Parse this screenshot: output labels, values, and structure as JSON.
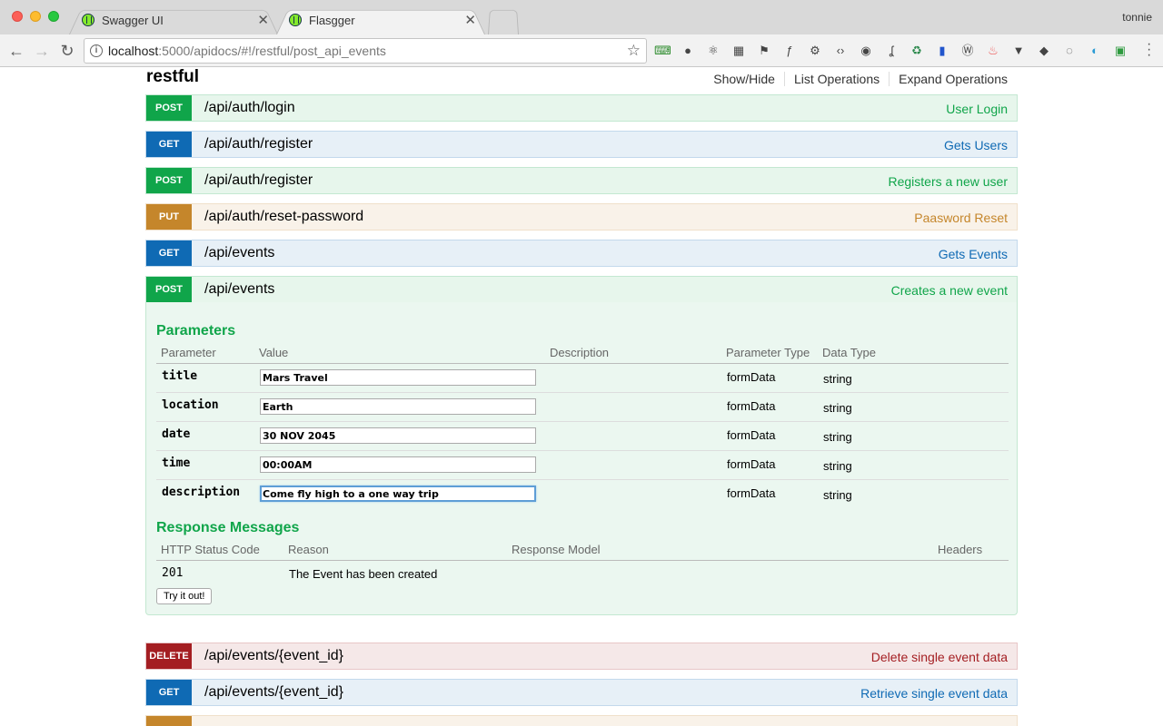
{
  "browser": {
    "tabs": [
      {
        "title": "Swagger UI",
        "active": false
      },
      {
        "title": "Flasgger",
        "active": true
      }
    ],
    "profile_name": "tonnie",
    "url_host": "localhost",
    "url_rest": ":5000/apidocs/#!/restful/post_api_events",
    "extensions": [
      "code-new-icon",
      "bulb-icon",
      "react-icon",
      "grid-icon",
      "tag-icon",
      "fx-icon",
      "gear-globe-icon",
      "code-icon",
      "eye-icon",
      "hook-icon",
      "recycle-icon",
      "pin-icon",
      "wordpress-icon",
      "fire-icon",
      "vee-icon",
      "dropbox-icon",
      "bulb-outline-icon",
      "cw-icon",
      "cors-icon"
    ]
  },
  "resource": {
    "title": "restful",
    "links": [
      "Show/Hide",
      "List Operations",
      "Expand Operations"
    ]
  },
  "operations": [
    {
      "method": "POST",
      "path": "/api/auth/login",
      "summary": "User Login"
    },
    {
      "method": "GET",
      "path": "/api/auth/register",
      "summary": "Gets Users"
    },
    {
      "method": "POST",
      "path": "/api/auth/register",
      "summary": "Registers a new user"
    },
    {
      "method": "PUT",
      "path": "/api/auth/reset-password",
      "summary": "Paasword Reset"
    },
    {
      "method": "GET",
      "path": "/api/events",
      "summary": "Gets Events"
    },
    {
      "method": "POST",
      "path": "/api/events",
      "summary": "Creates a new event"
    },
    {
      "method": "DELETE",
      "path": "/api/events/{event_id}",
      "summary": "Delete single event data"
    },
    {
      "method": "GET",
      "path": "/api/events/{event_id}",
      "summary": "Retrieve single event data"
    }
  ],
  "expanded": {
    "parameters_heading": "Parameters",
    "param_headers": [
      "Parameter",
      "Value",
      "Description",
      "Parameter Type",
      "Data Type"
    ],
    "params": [
      {
        "name": "title",
        "value": "Mars Travel",
        "param_type": "formData",
        "data_type": "string"
      },
      {
        "name": "location",
        "value": "Earth",
        "param_type": "formData",
        "data_type": "string"
      },
      {
        "name": "date",
        "value": "30 NOV 2045",
        "param_type": "formData",
        "data_type": "string"
      },
      {
        "name": "time",
        "value": "00:00AM",
        "param_type": "formData",
        "data_type": "string"
      },
      {
        "name": "description",
        "value": "Come fly high to a one way trip",
        "param_type": "formData",
        "data_type": "string"
      }
    ],
    "responses_heading": "Response Messages",
    "response_headers": [
      "HTTP Status Code",
      "Reason",
      "Response Model",
      "Headers"
    ],
    "responses": [
      {
        "code": "201",
        "reason": "The Event has been created"
      }
    ],
    "try_label": "Try it out!"
  },
  "colors": {
    "post": "#10a54a",
    "get": "#0f6ab4",
    "put": "#c5862b",
    "delete": "#a41e22"
  }
}
